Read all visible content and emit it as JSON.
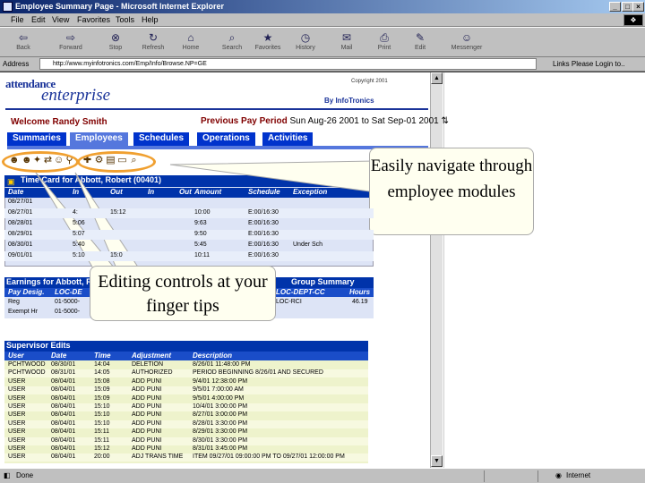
{
  "window": {
    "title": "Employee Summary Page - Microsoft Internet Explorer",
    "buttons": [
      "_",
      "□",
      "×"
    ]
  },
  "menu": [
    "File",
    "Edit",
    "View",
    "Favorites",
    "Tools",
    "Help"
  ],
  "toolbar": [
    {
      "label": "Back",
      "icon": "back-arrow-icon",
      "glyph": "⇦"
    },
    {
      "label": "Forward",
      "icon": "forward-arrow-icon",
      "glyph": "⇨"
    },
    {
      "label": "Stop",
      "icon": "stop-icon",
      "glyph": "⊗"
    },
    {
      "label": "Refresh",
      "icon": "refresh-icon",
      "glyph": "↻"
    },
    {
      "label": "Home",
      "icon": "home-icon",
      "glyph": "⌂"
    },
    {
      "label": "Search",
      "icon": "search-icon",
      "glyph": "⌕"
    },
    {
      "label": "Favorites",
      "icon": "favorites-icon",
      "glyph": "★"
    },
    {
      "label": "History",
      "icon": "history-icon",
      "glyph": "◷"
    },
    {
      "label": "Mail",
      "icon": "mail-icon",
      "glyph": "✉"
    },
    {
      "label": "Print",
      "icon": "print-icon",
      "glyph": "⎙"
    },
    {
      "label": "Edit",
      "icon": "edit-icon",
      "glyph": "✎"
    },
    {
      "label": "Messenger",
      "icon": "messenger-icon",
      "glyph": "☺"
    }
  ],
  "address": {
    "label": "Address",
    "url": "http://www.myinfotronics.com/Emp/Info/Browse.NP=GE",
    "links": "Links",
    "login": "Please Login to.."
  },
  "page": {
    "logo_top": "attendance",
    "logo_bottom": "enterprise",
    "copyright": "Copyright 2001",
    "by": "By InfoTronics",
    "welcome": "Welcome Randy Smith",
    "pay_period_label": "Previous Pay Period",
    "pay_period_value": "Sun Aug-26 2001 to Sat Sep-01 2001",
    "tabs": [
      "Summaries",
      "Employees",
      "Schedules",
      "Operations",
      "Activities"
    ]
  },
  "time_card": {
    "title": "Time Card for Abbott, Robert (00401)",
    "columns": [
      "Date",
      "In",
      "Out",
      "In",
      "Out",
      "Amount",
      "Schedule",
      "Exception"
    ],
    "rows": [
      [
        "08/27/01",
        "",
        "",
        "",
        "",
        "",
        "",
        ""
      ],
      [
        "08/27/01",
        "4:",
        "15:12",
        "",
        "",
        "10:00",
        "E:00/16:30",
        ""
      ],
      [
        "08/28/01",
        "5:06",
        "",
        "",
        "",
        "9:63",
        "E:00/16:30",
        ""
      ],
      [
        "08/29/01",
        "5:07",
        "",
        "",
        "",
        "9:50",
        "E:00/16:30",
        ""
      ],
      [
        "08/30/01",
        "5:40",
        "",
        "",
        "",
        "5:45",
        "E:00/16:30",
        "Under Sch"
      ],
      [
        "09/01/01",
        "5:10",
        "15:0",
        "",
        "",
        "10:11",
        "E:00/16:30",
        ""
      ]
    ]
  },
  "earnings": {
    "title": "Earnings for Abbott, Robert (00401)",
    "group_title": "Group Summary",
    "columns": [
      "Pay Desig.",
      "LOC-DE",
      "LOC-DEPT-CC",
      "Hours"
    ],
    "rows": [
      [
        "Reg",
        "01-5000-",
        "LOC-RCI",
        "46.19"
      ],
      [
        "Exempt Hr",
        "01-5000-",
        "",
        ""
      ]
    ]
  },
  "supervisor": {
    "title": "Supervisor Edits",
    "columns": [
      "User",
      "Date",
      "Time",
      "Adjustment",
      "Description"
    ],
    "rows": [
      [
        "PCHTWOOD",
        "08/30/01",
        "14:04",
        "DELETION",
        "8/26/01 11:48:00 PM"
      ],
      [
        "PCHTWOOD",
        "08/31/01",
        "14:05",
        "AUTHORIZED",
        "PERIOD BEGINNING 8/26/01 AND SECURED"
      ],
      [
        "USER",
        "08/04/01",
        "15:08",
        "ADD PUNI",
        "9/4/01 12:38:00 PM"
      ],
      [
        "USER",
        "08/04/01",
        "15:09",
        "ADD PUNI",
        "9/5/01 7:00:00 AM"
      ],
      [
        "USER",
        "08/04/01",
        "15:09",
        "ADD PUNI",
        "9/5/01 4:00:00 PM"
      ],
      [
        "USER",
        "08/04/01",
        "15:10",
        "ADD PUNI",
        "10/4/01 3:00:00 PM"
      ],
      [
        "USER",
        "08/04/01",
        "15:10",
        "ADD PUNI",
        "8/27/01 3:00:00 PM"
      ],
      [
        "USER",
        "08/04/01",
        "15:10",
        "ADD PUNI",
        "8/28/01 3:30:00 PM"
      ],
      [
        "USER",
        "08/04/01",
        "15:11",
        "ADD PUNI",
        "8/29/01 3:30:00 PM"
      ],
      [
        "USER",
        "08/04/01",
        "15:11",
        "ADD PUNI",
        "8/30/01 3:30:00 PM"
      ],
      [
        "USER",
        "08/04/01",
        "15:12",
        "ADD PUNI",
        "8/31/01 3:45:00 PM"
      ],
      [
        "USER",
        "08/04/01",
        "20:00",
        "ADJ TRANS TIME",
        "ITEM 09/27/01 09:00:00 PM TO 09/27/01 12:00:00 PM"
      ]
    ]
  },
  "callouts": {
    "navigate": "Easily navigate through employee modules",
    "editing": "Editing controls at your finger tips"
  },
  "status": {
    "left": "Done",
    "zone": "Internet"
  },
  "colors": {
    "header_blue": "#0033aa",
    "tab_blue": "#0033cc",
    "highlight_orange": "#f0a030",
    "welcome_red": "#800000"
  }
}
